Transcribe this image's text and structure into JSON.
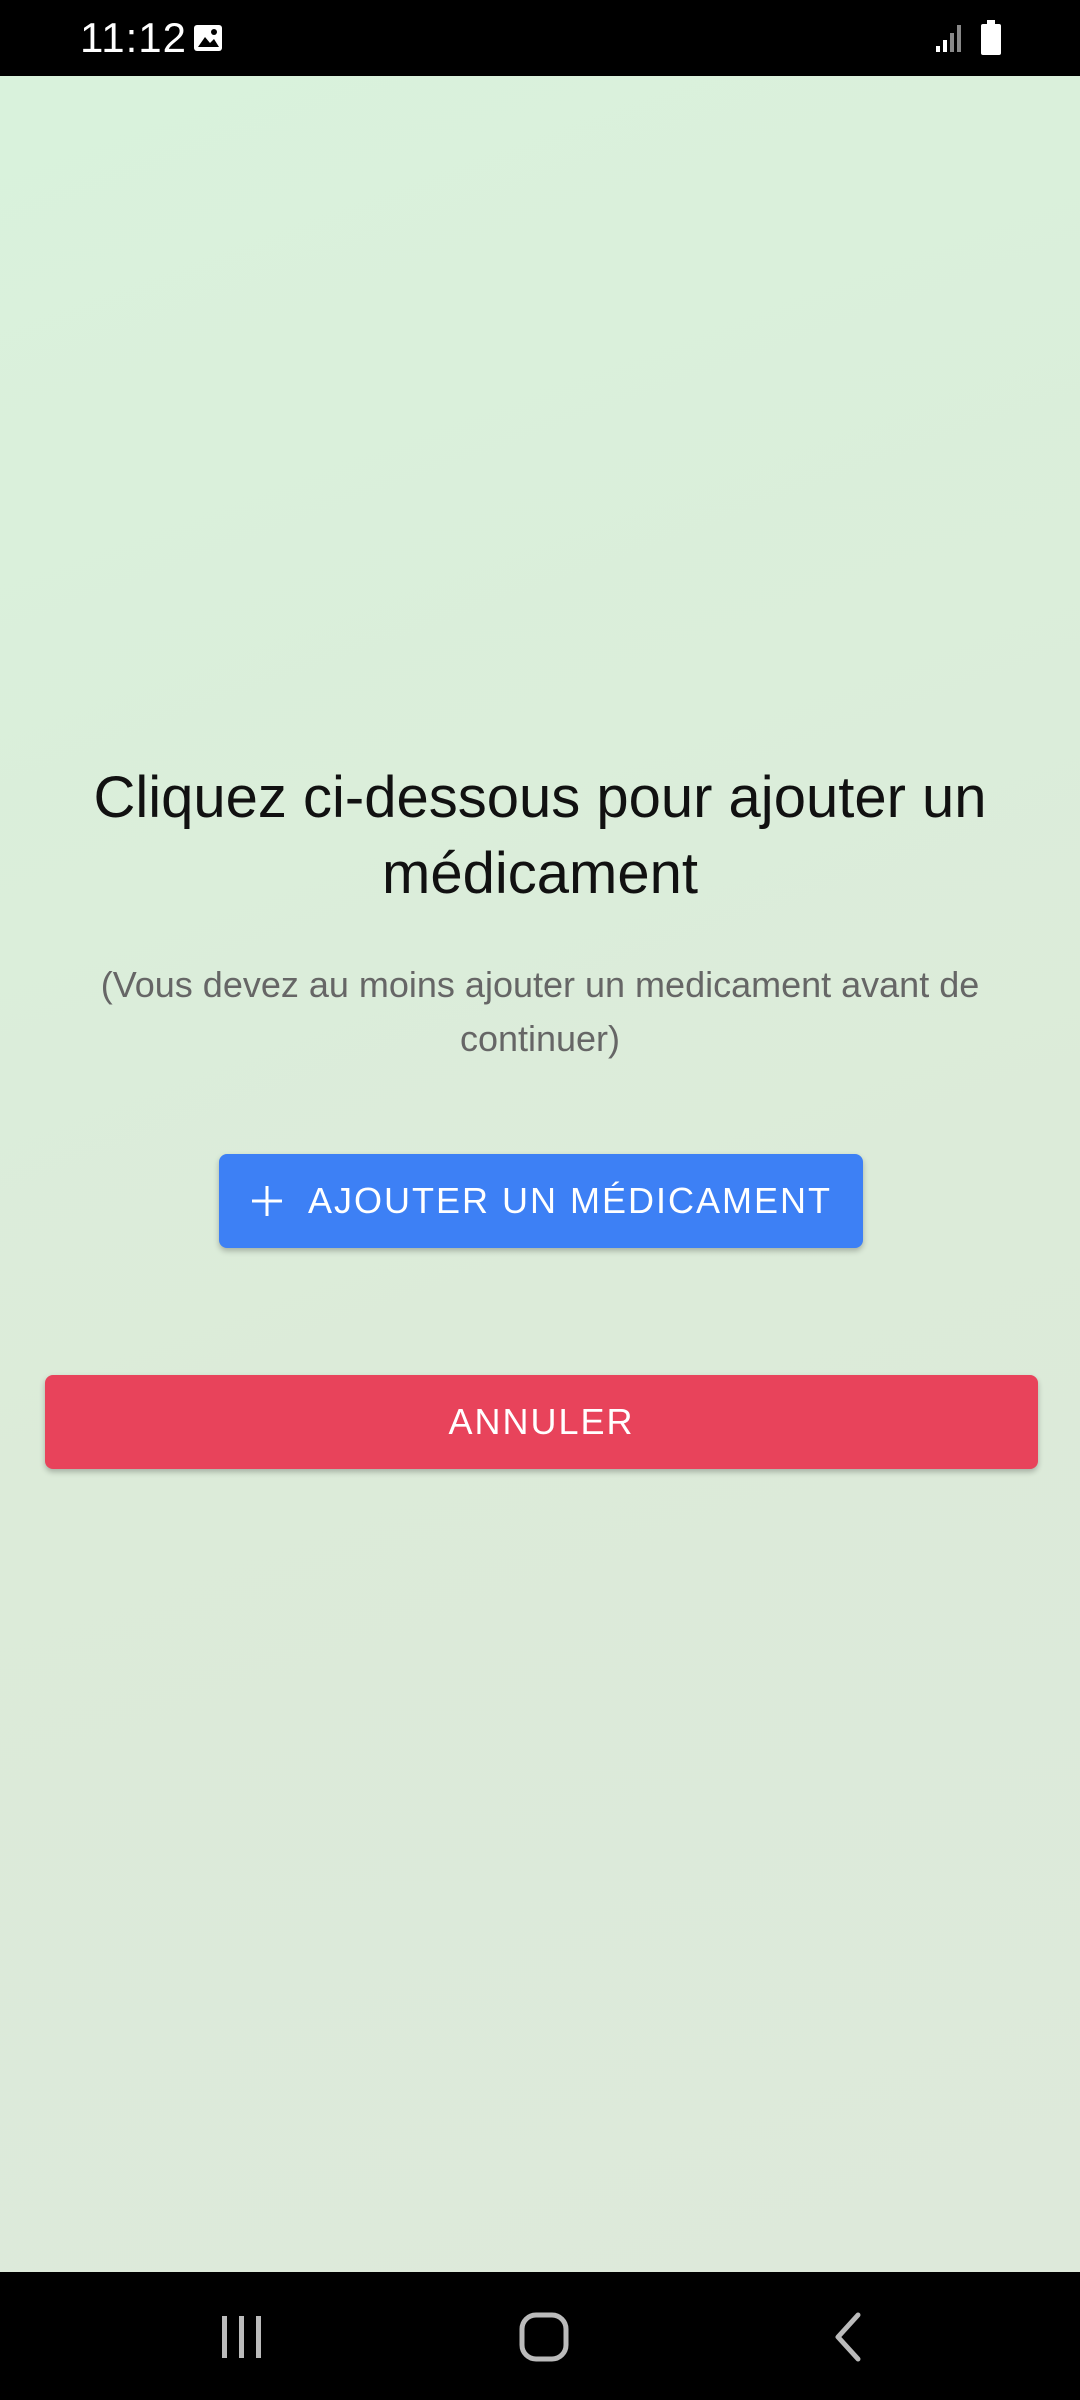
{
  "status_bar": {
    "time": "11:12",
    "icons": [
      "gallery-icon",
      "signal-icon",
      "battery-icon"
    ]
  },
  "main": {
    "title": "Cliquez ci-dessous pour ajouter un médicament",
    "subtitle": "(Vous devez au moins ajouter un medicament avant de continuer)",
    "add_button_label": "AJOUTER UN MÉDICAMENT",
    "add_button_icon": "plus-icon",
    "cancel_button_label": "ANNULER"
  },
  "nav_bar": {
    "icons": [
      "recents-icon",
      "home-icon",
      "back-icon"
    ]
  },
  "colors": {
    "background": "#dcebd9",
    "primary": "#3d80f5",
    "danger": "#e8435b"
  }
}
